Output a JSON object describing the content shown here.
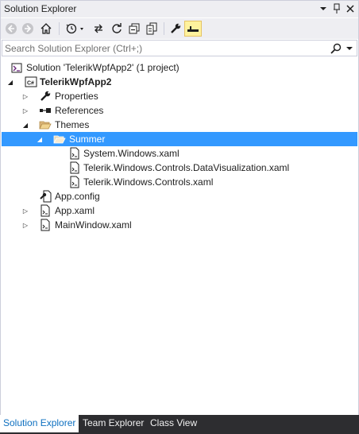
{
  "window": {
    "title": "Solution Explorer",
    "pin_glyph": "▾",
    "close_glyph": "✕"
  },
  "toolbar": {
    "icons": [
      "back-icon",
      "forward-icon",
      "home-icon",
      "history-icon",
      "sync-icon",
      "refresh-icon",
      "collapse-all-icon",
      "show-all-files-icon",
      "properties-icon",
      "preview-icon"
    ]
  },
  "search": {
    "placeholder": "Search Solution Explorer (Ctrl+;)"
  },
  "tree": {
    "items": [
      {
        "label": "Solution 'TelerikWpfApp2' (1 project)",
        "icon": "solution-icon"
      },
      {
        "label": "TelerikWpfApp2",
        "icon": "csharp-project-icon",
        "bold": true
      },
      {
        "label": "Properties",
        "icon": "wrench-icon"
      },
      {
        "label": "References",
        "icon": "references-icon"
      },
      {
        "label": "Themes",
        "icon": "folder-icon"
      },
      {
        "label": "Summer",
        "icon": "folder-open-icon",
        "selected": true
      },
      {
        "label": "System.Windows.xaml",
        "icon": "xaml-file-icon"
      },
      {
        "label": "Telerik.Windows.Controls.DataVisualization.xaml",
        "icon": "xaml-file-icon"
      },
      {
        "label": "Telerik.Windows.Controls.xaml",
        "icon": "xaml-file-icon"
      },
      {
        "label": "App.config",
        "icon": "config-file-icon"
      },
      {
        "label": "App.xaml",
        "icon": "xaml-file-icon"
      },
      {
        "label": "MainWindow.xaml",
        "icon": "xaml-file-icon"
      }
    ]
  },
  "tabs": [
    {
      "label": "Solution Explorer",
      "active": true
    },
    {
      "label": "Team Explorer"
    },
    {
      "label": "Class View"
    }
  ],
  "colors": {
    "selection": "#3399ff",
    "chrome": "#eeeef2",
    "tab_bar": "#2d2d30",
    "active_tab_text": "#0e70c0"
  }
}
